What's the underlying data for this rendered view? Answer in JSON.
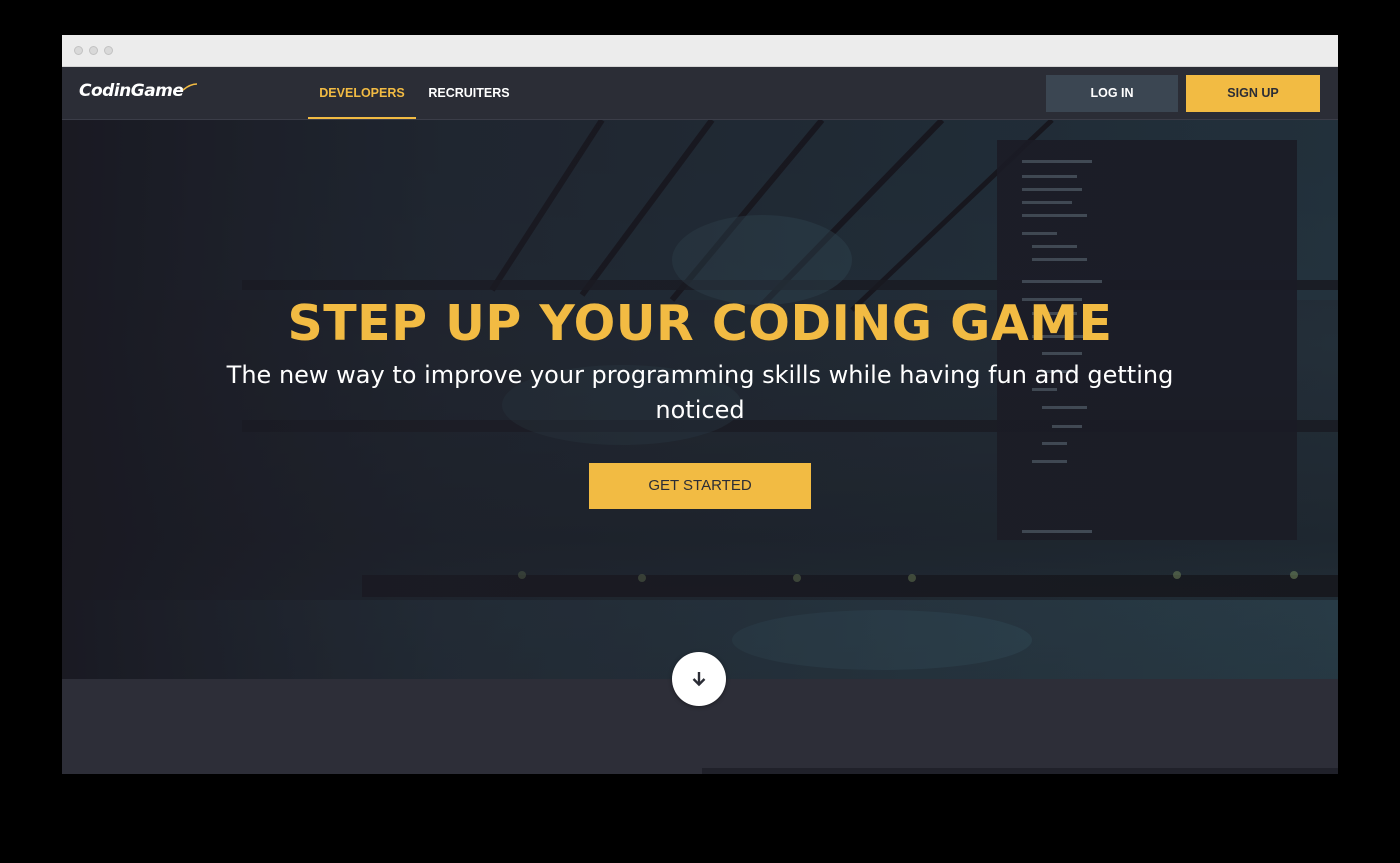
{
  "navbar": {
    "logo_text": "CodinGame",
    "tabs": [
      {
        "label": "DEVELOPERS",
        "active": true
      },
      {
        "label": "RECRUITERS",
        "active": false
      }
    ],
    "login_label": "LOG IN",
    "signup_label": "SIGN UP"
  },
  "hero": {
    "title": "STEP UP YOUR CODING GAME",
    "subtitle": "The new way to improve your programming skills while having fun and getting noticed",
    "cta_label": "GET STARTED",
    "scroll_icon": "arrow-down-icon"
  },
  "colors": {
    "accent": "#f2bb43",
    "navbar": "#2b2d36",
    "login_button": "#3b4652",
    "hero_overlay": "#25343f",
    "page_background": "#262731"
  }
}
